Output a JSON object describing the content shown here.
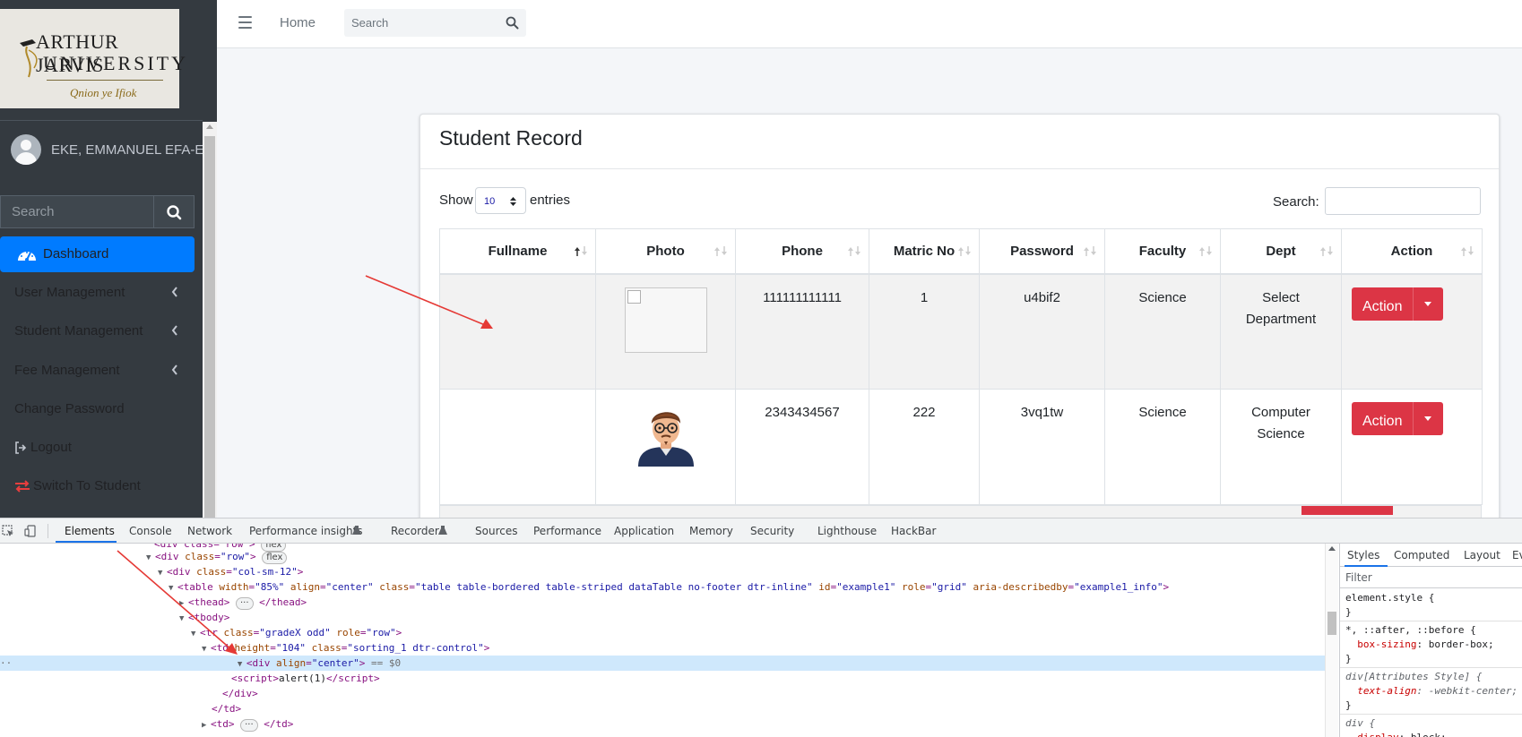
{
  "logo": {
    "line1": "ARTHUR JARVIS",
    "line2": "UNIVERSITY",
    "motto": "Qnion ye Ifiok"
  },
  "sidebar": {
    "user_name": "EKE, EMMANUEL EFA-EV...",
    "search_placeholder": "Search",
    "items": [
      {
        "label": "Dashboard",
        "icon": "tachometer-icon",
        "active": true
      },
      {
        "label": "User Management",
        "icon": "chevron-left-icon"
      },
      {
        "label": "Student Management",
        "icon": "chevron-left-icon"
      },
      {
        "label": "Fee Management",
        "icon": "chevron-left-icon"
      },
      {
        "label": "Change Password"
      },
      {
        "label": "Logout",
        "icon": "sign-out-icon"
      },
      {
        "label": "Switch To Student",
        "icon": "exchange-icon"
      }
    ]
  },
  "topbar": {
    "home_label": "Home",
    "search_placeholder": "Search"
  },
  "card": {
    "title": "Student Record",
    "show_label": "Show",
    "entries_value": "10",
    "entries_label": "entries",
    "search_label": "Search:"
  },
  "table": {
    "columns": [
      "Fullname",
      "Photo",
      "Phone",
      "Matric No",
      "Password",
      "Faculty",
      "Dept",
      "Action"
    ],
    "rows": [
      {
        "fullname": "",
        "photo": "broken-image",
        "phone": "111111111111",
        "matric": "1",
        "password": "u4bif2",
        "faculty": "Science",
        "dept": "Select Department",
        "action": "Action"
      },
      {
        "fullname": "",
        "photo": "avatar-image",
        "phone": "2343434567",
        "matric": "222",
        "password": "3vq1tw",
        "faculty": "Science",
        "dept": "Computer Science",
        "action": "Action"
      }
    ]
  },
  "devtools": {
    "tabs": [
      "Elements",
      "Console",
      "Network",
      "Performance insights",
      "Recorder",
      "Sources",
      "Performance",
      "Application",
      "Memory",
      "Security",
      "Lighthouse",
      "HackBar"
    ],
    "active_tab": "Elements",
    "styles_tabs": [
      "Styles",
      "Computed",
      "Layout",
      "Ev"
    ],
    "filter_label": "Filter",
    "selected_suffix": "== $0",
    "script_text": "alert(1)",
    "table_attr_values": {
      "width": "\"85%\"",
      "align": "\"center\"",
      "class": "\"table table-bordered table-striped dataTable no-footer dtr-inline\"",
      "id": "\"example1\"",
      "role": "\"grid\"",
      "aria_describedby": "\"example1_info\""
    }
  },
  "colors": {
    "sidebar_bg": "#343a40",
    "primary": "#007bff",
    "danger": "#dc3545",
    "arrow": "#e53935"
  }
}
